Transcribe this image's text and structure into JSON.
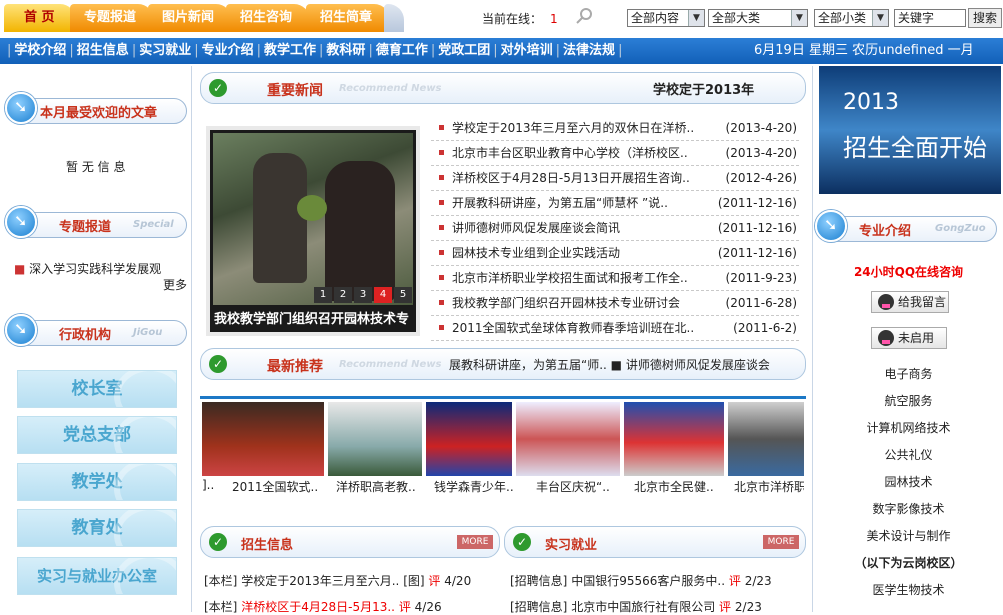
{
  "tabs": [
    "首 页",
    "专题报道",
    "图片新闻",
    "招生咨询",
    "招生简章"
  ],
  "online": {
    "label": "当前在线：",
    "count": "1"
  },
  "selects": [
    "全部内容",
    "全部大类",
    "全部小类"
  ],
  "keyword": "关键字",
  "search_btn": "搜索",
  "nav": [
    "学校介绍",
    "招生信息",
    "实习就业",
    "专业介绍",
    "教学工作",
    "教科研",
    "德育工作",
    "党政工团",
    "对外培训",
    "法律法规"
  ],
  "date": "6月19日 星期三  农历undefined 一月",
  "left": {
    "popular": {
      "title": "本月最受欢迎的文章",
      "empty": "暂 无 信 息"
    },
    "special": {
      "title": "专题报道",
      "en": "Special",
      "item": "深入学习实践科学发展观",
      "more": "更多"
    },
    "org": {
      "title": "行政机构",
      "en": "JiGou",
      "buttons": [
        "校长室",
        "党总支部",
        "教学处",
        "教育处",
        "实习与就业办公室"
      ]
    }
  },
  "news": {
    "title": "重要新闻",
    "en": "Recommend News",
    "marquee": "学校定于2013年",
    "slide_caption": "我校教学部门组织召开园林技术专",
    "pages": [
      "1",
      "2",
      "3",
      "4",
      "5"
    ],
    "items": [
      {
        "t": "学校定于2013年三月至六月的双休日在洋桥..",
        "d": "(2013-4-20)"
      },
      {
        "t": "北京市丰台区职业教育中心学校（洋桥校区..",
        "d": "(2013-4-20)"
      },
      {
        "t": "洋桥校区于4月28日-5月13日开展招生咨询..",
        "d": "(2012-4-26)"
      },
      {
        "t": "开展教科研讲座，为第五届“师慧杯 ”说..",
        "d": "(2011-12-16)"
      },
      {
        "t": "讲师德树师风促发展座谈会简讯",
        "d": "(2011-12-16)"
      },
      {
        "t": "园林技术专业组到企业实践活动",
        "d": "(2011-12-16)"
      },
      {
        "t": "北京市洋桥职业学校招生面试和报考工作全..",
        "d": "(2011-9-23)"
      },
      {
        "t": "我校教学部门组织召开园林技术专业研讨会",
        "d": "(2011-6-28)"
      },
      {
        "t": "2011全国软式垒球体育教师春季培训班在北..",
        "d": "(2011-6-2)"
      }
    ]
  },
  "recommend": {
    "title": "最新推荐",
    "en": "Recommend News",
    "marquee": "展教科研讲座，为第五届“师..  ■ 讲师德树师风促发展座谈会"
  },
  "photos": [
    "2011全国软式..",
    "洋桥职高老教..",
    "钱学森青少年..",
    "丰台区庆祝“..",
    "北京市全民健..",
    "北京市洋桥职"
  ],
  "enroll": {
    "title": "招生信息",
    "more": "MORE",
    "items": [
      {
        "pre": "[本栏]",
        "t": "学校定于2013年三月至六月..",
        "tag": "[图]",
        "c": "评",
        "d": "4/20"
      },
      {
        "pre": "[本栏]",
        "t": "洋桥校区于4月28日-5月13..",
        "tag": "",
        "c": "评",
        "d": "4/26"
      }
    ]
  },
  "jobs": {
    "title": "实习就业",
    "more": "MORE",
    "items": [
      {
        "pre": "[招聘信息]",
        "t": "中国银行95566客户服务中..",
        "c": "评",
        "d": "2/23"
      },
      {
        "pre": "[招聘信息]",
        "t": "北京市中国旅行社有限公司",
        "c": "评",
        "d": "2/23"
      }
    ]
  },
  "right": {
    "banner": {
      "year": "2013",
      "slogan": "招生全面开始"
    },
    "major_title": "专业介绍",
    "major_en": "GongZuo",
    "qq_title": "24小时QQ在线咨询",
    "qq1": "给我留言",
    "qq2": "未启用",
    "majors": [
      "电子商务",
      "航空服务",
      "计算机网络技术",
      "公共礼仪",
      "园林技术",
      "数字影像技术",
      "美术设计与制作",
      "（以下为云岗校区）",
      "医学生物技术"
    ]
  }
}
